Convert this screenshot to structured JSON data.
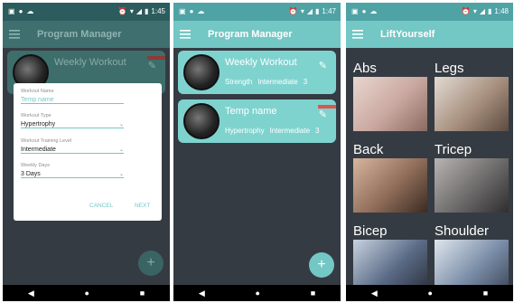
{
  "phone1": {
    "status": {
      "time": "1:45"
    },
    "appbar": {
      "title": "Program Manager"
    },
    "card": {
      "title": "Weekly Workout"
    },
    "dialog": {
      "name_label": "Workout Name",
      "name_placeholder": "Temp name",
      "type_label": "Workout Type",
      "type_value": "Hypertrophy",
      "level_label": "Workout Training Level",
      "level_value": "Intermediate",
      "days_label": "Weekly Days",
      "days_value": "3 Days",
      "cancel": "CANCEL",
      "next": "NEXT"
    },
    "fab": "+"
  },
  "phone2": {
    "status": {
      "time": "1:47"
    },
    "appbar": {
      "title": "Program Manager"
    },
    "cards": [
      {
        "title": "Weekly Workout",
        "type": "Strength",
        "level": "Intermediate",
        "days": "3"
      },
      {
        "title": "Temp name",
        "type": "Hypertrophy",
        "level": "Intermediate",
        "days": "3"
      }
    ],
    "fab": "+"
  },
  "phone3": {
    "status": {
      "time": "1:48"
    },
    "appbar": {
      "title": "LiftYourself"
    },
    "categories": [
      {
        "label": "Abs",
        "color": "#c9a7a0"
      },
      {
        "label": "Legs",
        "color": "#a78f7e"
      },
      {
        "label": "Back",
        "color": "#8e6c59"
      },
      {
        "label": "Tricep",
        "color": "#6c6a6a"
      },
      {
        "label": "Bicep",
        "color": "#5a6b86"
      },
      {
        "label": "Shoulder",
        "color": "#7b8ea8"
      }
    ]
  },
  "icons": {
    "menu": "hamburger-icon",
    "pencil": "pencil-icon",
    "back": "back-triangle-icon",
    "home": "home-circle-icon",
    "recents": "recents-square-icon"
  },
  "colors": {
    "accent": "#73c7c4",
    "card": "#7fd3cf",
    "background": "#353b42",
    "ribbon": "#e0544d"
  }
}
